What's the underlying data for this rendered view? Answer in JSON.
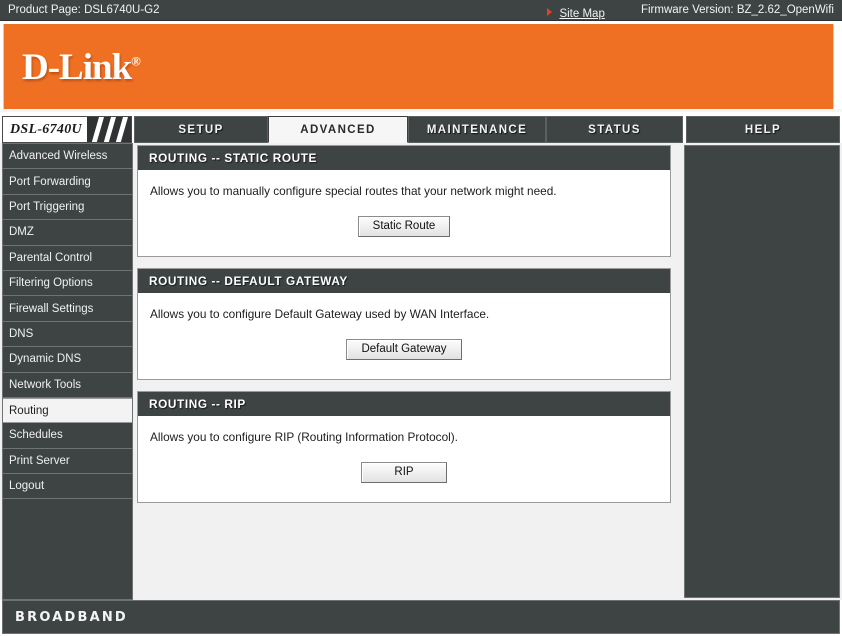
{
  "topbar": {
    "product_page": "Product Page: DSL6740U-G2",
    "site_map": "Site Map",
    "firmware": "Firmware Version: BZ_2.62_OpenWifi",
    "arrow_icon": "triangle-right-icon",
    "arrow_color": "#e8401c"
  },
  "brand": {
    "logo_text": "D-Link",
    "registered_mark": "®",
    "banner_color": "#f07023"
  },
  "nav": {
    "model": "DSL-6740U",
    "tabs": [
      {
        "label": "SETUP",
        "active": false
      },
      {
        "label": "ADVANCED",
        "active": true
      },
      {
        "label": "MAINTENANCE",
        "active": false
      },
      {
        "label": "STATUS",
        "active": false
      },
      {
        "label": "HELP",
        "active": false
      }
    ]
  },
  "sidebar": {
    "items": [
      {
        "label": "Advanced Wireless",
        "active": false
      },
      {
        "label": "Port Forwarding",
        "active": false
      },
      {
        "label": "Port Triggering",
        "active": false
      },
      {
        "label": "DMZ",
        "active": false
      },
      {
        "label": "Parental Control",
        "active": false
      },
      {
        "label": "Filtering Options",
        "active": false
      },
      {
        "label": "Firewall Settings",
        "active": false
      },
      {
        "label": "DNS",
        "active": false
      },
      {
        "label": "Dynamic DNS",
        "active": false
      },
      {
        "label": "Network Tools",
        "active": false
      },
      {
        "label": "Routing",
        "active": true
      },
      {
        "label": "Schedules",
        "active": false
      },
      {
        "label": "Print Server",
        "active": false
      },
      {
        "label": "Logout",
        "active": false
      }
    ]
  },
  "panels": [
    {
      "title": "ROUTING -- STATIC ROUTE",
      "description": "Allows you to manually configure special routes that your network might need.",
      "button": "Static Route"
    },
    {
      "title": "ROUTING -- DEFAULT GATEWAY",
      "description": "Allows you to configure Default Gateway used by WAN Interface.",
      "button": "Default Gateway"
    },
    {
      "title": "ROUTING -- RIP",
      "description": "Allows you to configure RIP (Routing Information Protocol).",
      "button": "RIP"
    }
  ],
  "footer": {
    "text": "BROADBAND"
  }
}
